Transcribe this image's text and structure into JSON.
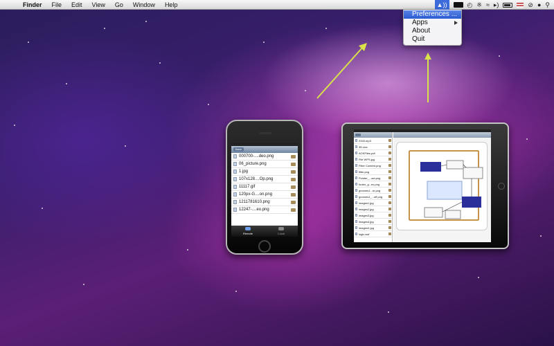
{
  "menubar": {
    "app_name": "Finder",
    "menus": [
      "File",
      "Edit",
      "View",
      "Go",
      "Window",
      "Help"
    ],
    "apple_glyph": "",
    "tray_icons": [
      "wifi-remote-icon",
      "display-icon",
      "time-machine-icon",
      "bluetooth-icon",
      "wifi-icon",
      "volume-icon",
      "battery-icon",
      "flag-icon",
      "sync-icon",
      "user-icon",
      "spotlight-icon"
    ]
  },
  "dropdown": {
    "items": [
      {
        "label": "Preferences ...",
        "highlighted": true
      },
      {
        "label": "Apps",
        "has_submenu": true
      },
      {
        "label": "About"
      },
      {
        "label": "Quit"
      }
    ]
  },
  "iphone": {
    "nav_back": "Back",
    "files": [
      "000700-....deo.png",
      "06_picture.png",
      "1.jpg",
      "107x128....Op.png",
      "11117.gif",
      "120px-G....on.png",
      "1211781610.png",
      "12247-....eo.png"
    ],
    "tabs": [
      "Remote",
      "Local"
    ]
  },
  "ipad": {
    "files": [
      "2333.mp3",
      "3D.doc",
      "AOSFiles.pdf",
      "File WPS.jpg",
      "Filter Content.png",
      "filter.png",
      "Pointer_...act.png",
      "footer_g...ex.png",
      "gnomes1...re.png",
      "gnomes1_...off.png",
      "images1.jpg",
      "images2.jpg",
      "images3.jpg",
      "images4.jpg",
      "imagesX.jpg",
      "logic.swf"
    ]
  },
  "colors": {
    "menu_highlight": "#2a5bd1",
    "arrow": "#d8e04a"
  }
}
